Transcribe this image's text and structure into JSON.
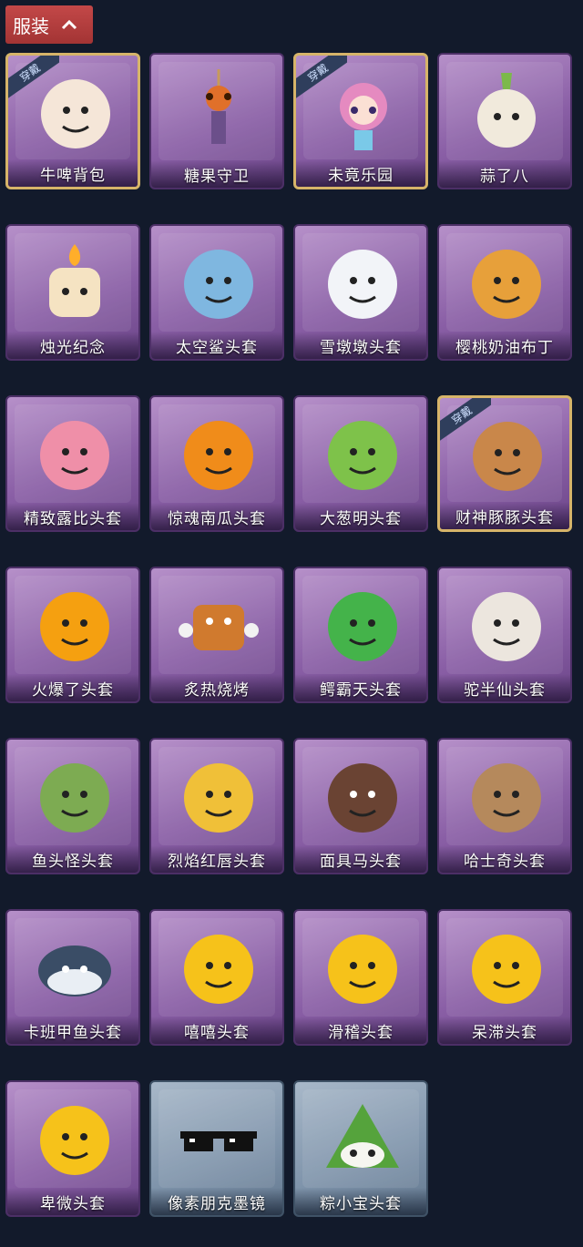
{
  "header": {
    "title": "服装",
    "toggle_icon": "chevron-up-icon",
    "accent": "#b43d3d"
  },
  "badge_text": "穿戴",
  "items": [
    {
      "id": "cow-beer-backpack",
      "label": "牛啤背包",
      "equipped": true,
      "variant": "purple",
      "color": "#f5e6d8",
      "icon": "cow-mug-icon"
    },
    {
      "id": "candy-guard",
      "label": "糖果守卫",
      "equipped": false,
      "variant": "purple",
      "color": "#e0702a",
      "icon": "pumpkin-scarecrow-icon"
    },
    {
      "id": "weiJing-park",
      "label": "未竟乐园",
      "equipped": true,
      "variant": "purple",
      "color": "#e58ac0",
      "icon": "doll-icon"
    },
    {
      "id": "suan-le-ba",
      "label": "蒜了八",
      "equipped": false,
      "variant": "purple",
      "color": "#f1eadc",
      "icon": "garlic-icon"
    },
    {
      "id": "candlelight",
      "label": "烛光纪念",
      "equipped": false,
      "variant": "purple",
      "color": "#f5e3c2",
      "icon": "candle-icon"
    },
    {
      "id": "space-shark",
      "label": "太空鲨头套",
      "equipped": false,
      "variant": "purple",
      "color": "#7fb7e0",
      "icon": "shark-icon"
    },
    {
      "id": "snowman",
      "label": "雪墩墩头套",
      "equipped": false,
      "variant": "purple",
      "color": "#f2f4f8",
      "icon": "snowman-icon"
    },
    {
      "id": "cherry-pudding",
      "label": "樱桃奶油布丁",
      "equipped": false,
      "variant": "purple",
      "color": "#e7a03a",
      "icon": "pudding-icon"
    },
    {
      "id": "lubi",
      "label": "精致露比头套",
      "equipped": false,
      "variant": "purple",
      "color": "#ef8fa8",
      "icon": "beaver-icon"
    },
    {
      "id": "pumpkin",
      "label": "惊魂南瓜头套",
      "equipped": false,
      "variant": "purple",
      "color": "#f08c1a",
      "icon": "pumpkin-icon"
    },
    {
      "id": "scallion",
      "label": "大葱明头套",
      "equipped": false,
      "variant": "purple",
      "color": "#7ec24a",
      "icon": "scallion-icon"
    },
    {
      "id": "capybara",
      "label": "财神豚豚头套",
      "equipped": true,
      "variant": "purple",
      "color": "#c9874a",
      "icon": "capybara-icon"
    },
    {
      "id": "fire",
      "label": "火爆了头套",
      "equipped": false,
      "variant": "purple",
      "color": "#f5a010",
      "icon": "flame-icon"
    },
    {
      "id": "barbecue",
      "label": "炙热烧烤",
      "equipped": false,
      "variant": "purple",
      "color": "#d07a2e",
      "icon": "meat-icon"
    },
    {
      "id": "crocodile",
      "label": "鳄霸天头套",
      "equipped": false,
      "variant": "purple",
      "color": "#44b34a",
      "icon": "crocodile-icon"
    },
    {
      "id": "alpaca",
      "label": "驼半仙头套",
      "equipped": false,
      "variant": "purple",
      "color": "#ece6de",
      "icon": "alpaca-icon"
    },
    {
      "id": "fish-head",
      "label": "鱼头怪头套",
      "equipped": false,
      "variant": "purple",
      "color": "#7dab52",
      "icon": "fish-head-icon"
    },
    {
      "id": "flame-lips",
      "label": "烈焰红唇头套",
      "equipped": false,
      "variant": "purple",
      "color": "#f0c038",
      "icon": "pikachu-mask-icon"
    },
    {
      "id": "horse",
      "label": "面具马头套",
      "equipped": false,
      "variant": "purple",
      "color": "#6a4333",
      "icon": "horse-icon"
    },
    {
      "id": "husky",
      "label": "哈士奇头套",
      "equipped": false,
      "variant": "purple",
      "color": "#b5895c",
      "icon": "dog-icon"
    },
    {
      "id": "kaban-fish",
      "label": "卡班甲鱼头套",
      "equipped": false,
      "variant": "purple",
      "color": "#3a4d66",
      "icon": "whale-icon"
    },
    {
      "id": "grin",
      "label": "嘻嘻头套",
      "equipped": false,
      "variant": "purple",
      "color": "#f6c21a",
      "icon": "grin-emoji-icon"
    },
    {
      "id": "silly",
      "label": "滑稽头套",
      "equipped": false,
      "variant": "purple",
      "color": "#f6c21a",
      "icon": "smirk-emoji-icon"
    },
    {
      "id": "dazed",
      "label": "呆滞头套",
      "equipped": false,
      "variant": "purple",
      "color": "#f6c21a",
      "icon": "stare-emoji-icon"
    },
    {
      "id": "humble",
      "label": "卑微头套",
      "equipped": false,
      "variant": "purple",
      "color": "#f6c21a",
      "icon": "shy-emoji-icon"
    },
    {
      "id": "pixel-sunglasses",
      "label": "像素朋克墨镜",
      "equipped": false,
      "variant": "gray",
      "color": "#111111",
      "icon": "pixel-sunglasses-icon"
    },
    {
      "id": "zongzi",
      "label": "粽小宝头套",
      "equipped": false,
      "variant": "gray",
      "color": "#55a33c",
      "icon": "zongzi-icon"
    }
  ]
}
